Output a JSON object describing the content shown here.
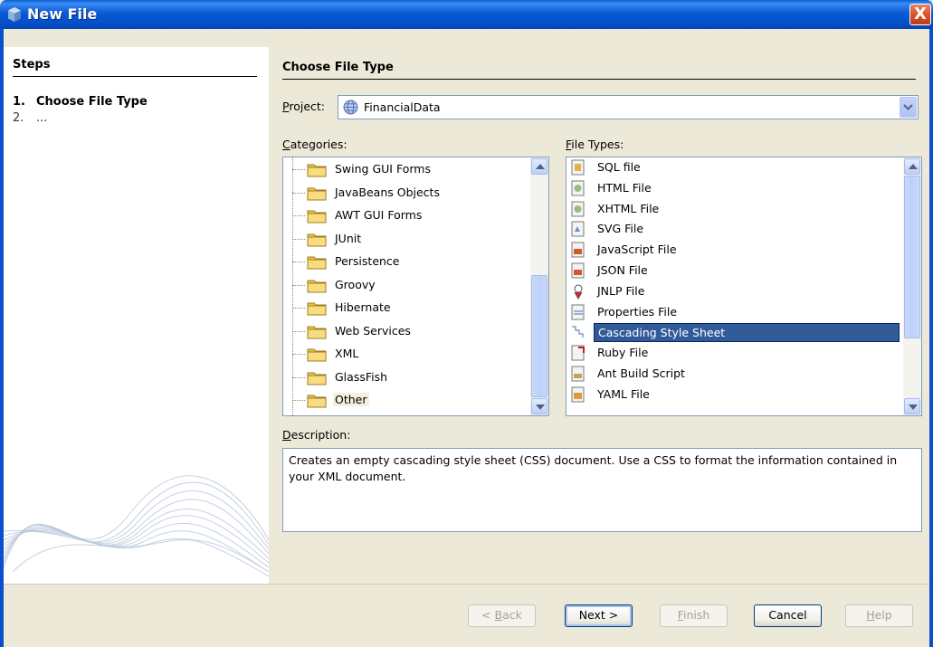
{
  "window": {
    "title": "New File",
    "close_glyph": "X"
  },
  "steps": {
    "title": "Steps",
    "items": [
      {
        "num": "1.",
        "label": "Choose File Type"
      },
      {
        "num": "2.",
        "label": "..."
      }
    ]
  },
  "main": {
    "section_title": "Choose File Type",
    "project_label": "Project:",
    "project_value": "FinancialData",
    "categories_label": "Categories:",
    "file_types_label": "File Types:",
    "categories": [
      "Swing GUI Forms",
      "JavaBeans Objects",
      "AWT GUI Forms",
      "JUnit",
      "Persistence",
      "Groovy",
      "Hibernate",
      "Web Services",
      "XML",
      "GlassFish",
      "Other"
    ],
    "selected_category": "Other",
    "file_types": [
      {
        "label": "SQL file",
        "icon": "sql-file-icon"
      },
      {
        "label": "HTML File",
        "icon": "html-file-icon"
      },
      {
        "label": "XHTML File",
        "icon": "xhtml-file-icon"
      },
      {
        "label": "SVG File",
        "icon": "svg-file-icon"
      },
      {
        "label": "JavaScript File",
        "icon": "javascript-file-icon"
      },
      {
        "label": "JSON File",
        "icon": "json-file-icon"
      },
      {
        "label": "JNLP File",
        "icon": "jnlp-file-icon"
      },
      {
        "label": "Properties File",
        "icon": "properties-file-icon"
      },
      {
        "label": "Cascading Style Sheet",
        "icon": "css-file-icon"
      },
      {
        "label": "Ruby File",
        "icon": "ruby-file-icon"
      },
      {
        "label": "Ant Build Script",
        "icon": "ant-script-icon"
      },
      {
        "label": "YAML File",
        "icon": "yaml-file-icon"
      }
    ],
    "selected_file_type": "Cascading Style Sheet",
    "description_label": "Description:",
    "description": "Creates an empty cascading style sheet (CSS) document. Use a CSS to format the information contained in your XML document."
  },
  "buttons": {
    "back": "< Back",
    "next": "Next >",
    "finish": "Finish",
    "cancel": "Cancel",
    "help": "Help"
  },
  "colors": {
    "title_bar": "#0a5fd6",
    "selection": "#315b98",
    "dialog_bg": "#ece9d8",
    "folder": "#f5d778"
  }
}
